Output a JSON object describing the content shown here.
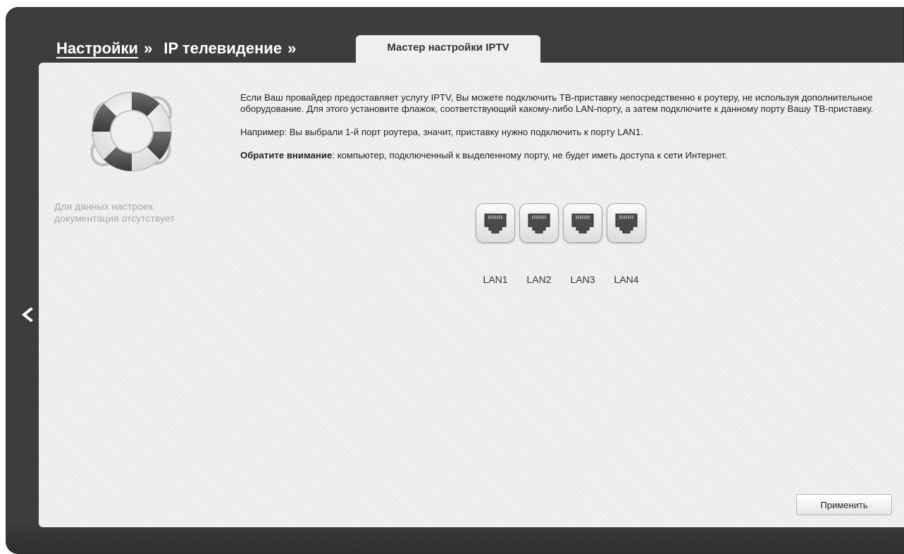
{
  "breadcrumb": {
    "level1": "Настройки",
    "level2": "IP телевидение",
    "separator": "»"
  },
  "tab": {
    "label": "Мастер настройки IPTV"
  },
  "sidebar": {
    "doc_note": "Для данных настроек документация отсутствует"
  },
  "description": {
    "paragraph1": "Если Ваш провайдер предоставляет услугу IPTV, Вы можете подключить ТВ-приставку непосредственно к роутеру, не используя дополнительное оборудование. Для этого установите флажок, соответствующий какому-либо LAN-порту, а затем подключите к данному порту Вашу ТВ-приставку.",
    "paragraph2": "Например: Вы выбрали 1-й порт роутера, значит, приставку нужно подключить к порту LAN1.",
    "note_label": "Обратите внимание",
    "note_text": ": компьютер, подключенный к выделенному порту, не будет иметь доступа к сети Интернет."
  },
  "ports": [
    {
      "label": "LAN1",
      "icon": "ethernet-port-icon",
      "selected": false
    },
    {
      "label": "LAN2",
      "icon": "ethernet-port-icon",
      "selected": false
    },
    {
      "label": "LAN3",
      "icon": "ethernet-port-icon",
      "selected": false
    },
    {
      "label": "LAN4",
      "icon": "ethernet-port-icon",
      "selected": false
    }
  ],
  "actions": {
    "apply_label": "Применить"
  },
  "icons": {
    "back": "chevron-left-icon",
    "help": "lifebuoy-icon"
  },
  "colors": {
    "frame": "#3d3d3d",
    "panel": "#efefef",
    "muted_text": "#a9a9a9"
  }
}
